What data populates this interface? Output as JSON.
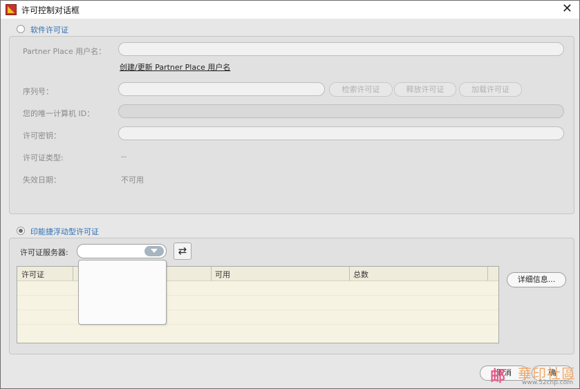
{
  "window": {
    "title": "许可控制对话框",
    "close_glyph": "✕",
    "app_icon": "app-logo-icon"
  },
  "software_license": {
    "section_label": "软件许可证",
    "selected": false,
    "partner_place_label": "Partner Place 用户名：",
    "partner_place_value": "",
    "create_update_link": "创建/更新 Partner Place 用户名",
    "serial_label": "序列号：",
    "serial_value": "",
    "retrieve_button": "检索许可证",
    "release_button": "释放许可证",
    "load_button": "加载许可证",
    "machine_id_label": "您的唯一计算机 ID：",
    "machine_id_value": "",
    "license_key_label": "许可密钥：",
    "license_key_value": "",
    "license_type_label": "许可证类型:",
    "license_type_value": "--",
    "expiry_label": "失效日期：",
    "expiry_value": "不可用"
  },
  "floating_license": {
    "section_label": "印能捷浮动型许可证",
    "selected": true,
    "server_label": "许可证服务器:",
    "server_value": "",
    "refresh_glyph": "⇄",
    "table": {
      "columns": [
        "许可证",
        "",
        "可用",
        "总数"
      ],
      "rows": []
    },
    "details_button": "详细信息..."
  },
  "footer": {
    "cancel_button": "取消",
    "partial_button": "确"
  },
  "watermark": {
    "logo": "邮",
    "text": "華印社區",
    "url": "www.52cnp.com"
  },
  "colors": {
    "section_label": "#2f6fb3",
    "combo_arrow": "#a6b5bf",
    "table_bg": "#f6f3e3"
  }
}
